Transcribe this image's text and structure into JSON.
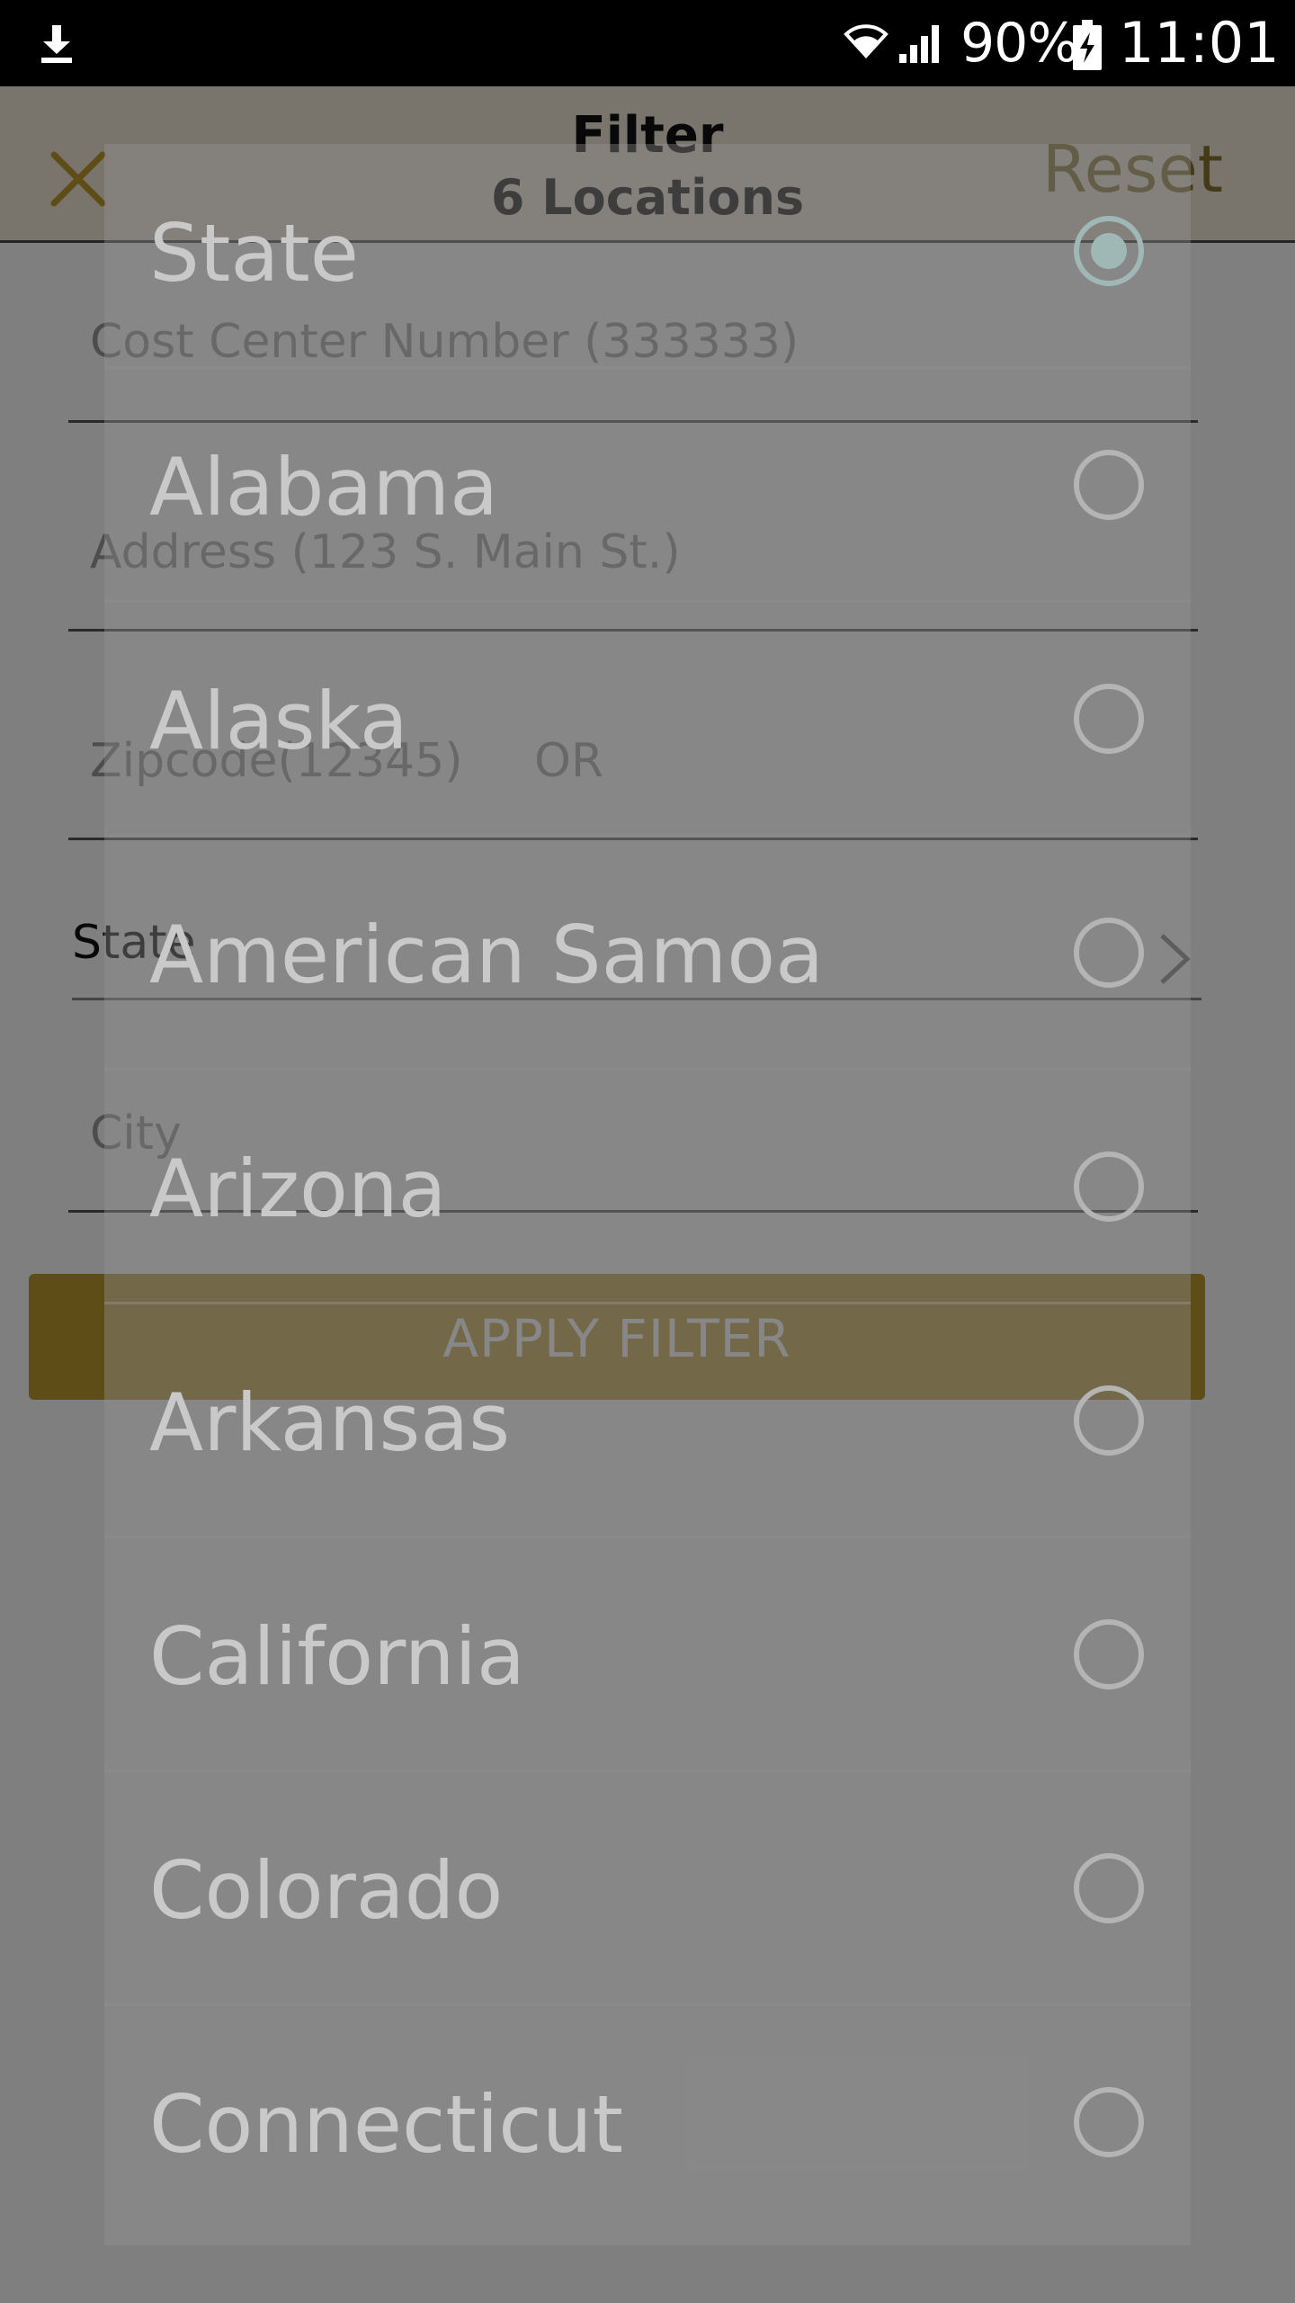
{
  "status_bar": {
    "download_icon": "download-icon",
    "wifi_icon": "wifi-icon",
    "signal_icon": "signal-icon",
    "battery_percent": "90%",
    "battery_icon": "battery-charging-icon",
    "time": "11:01"
  },
  "header": {
    "close_icon": "close-icon",
    "title": "Filter",
    "subtitle": "6 Locations",
    "reset_label": "Reset"
  },
  "form": {
    "cost_center_placeholder": "Cost Center Number (333333)",
    "address_placeholder": "Address (123 S. Main St.)",
    "zipcode_placeholder": "Zipcode(12345)",
    "or_label": "OR",
    "state_label": "State",
    "state_chevron_icon": "chevron-right-icon",
    "city_placeholder": "City",
    "apply_label": "APPLY FILTER"
  },
  "state_dialog": {
    "items": [
      {
        "label": "State",
        "selected": true
      },
      {
        "label": "Alabama",
        "selected": false
      },
      {
        "label": "Alaska",
        "selected": false
      },
      {
        "label": "American Samoa",
        "selected": false
      },
      {
        "label": "Arizona",
        "selected": false
      },
      {
        "label": "Arkansas",
        "selected": false
      },
      {
        "label": "California",
        "selected": false
      },
      {
        "label": "Colorado",
        "selected": false
      },
      {
        "label": "Connecticut",
        "selected": false
      }
    ]
  },
  "colors": {
    "accent_gold": "#bd9a2e",
    "header_bg": "#f3ebdb",
    "radio_selected": "#9fb8b6"
  }
}
